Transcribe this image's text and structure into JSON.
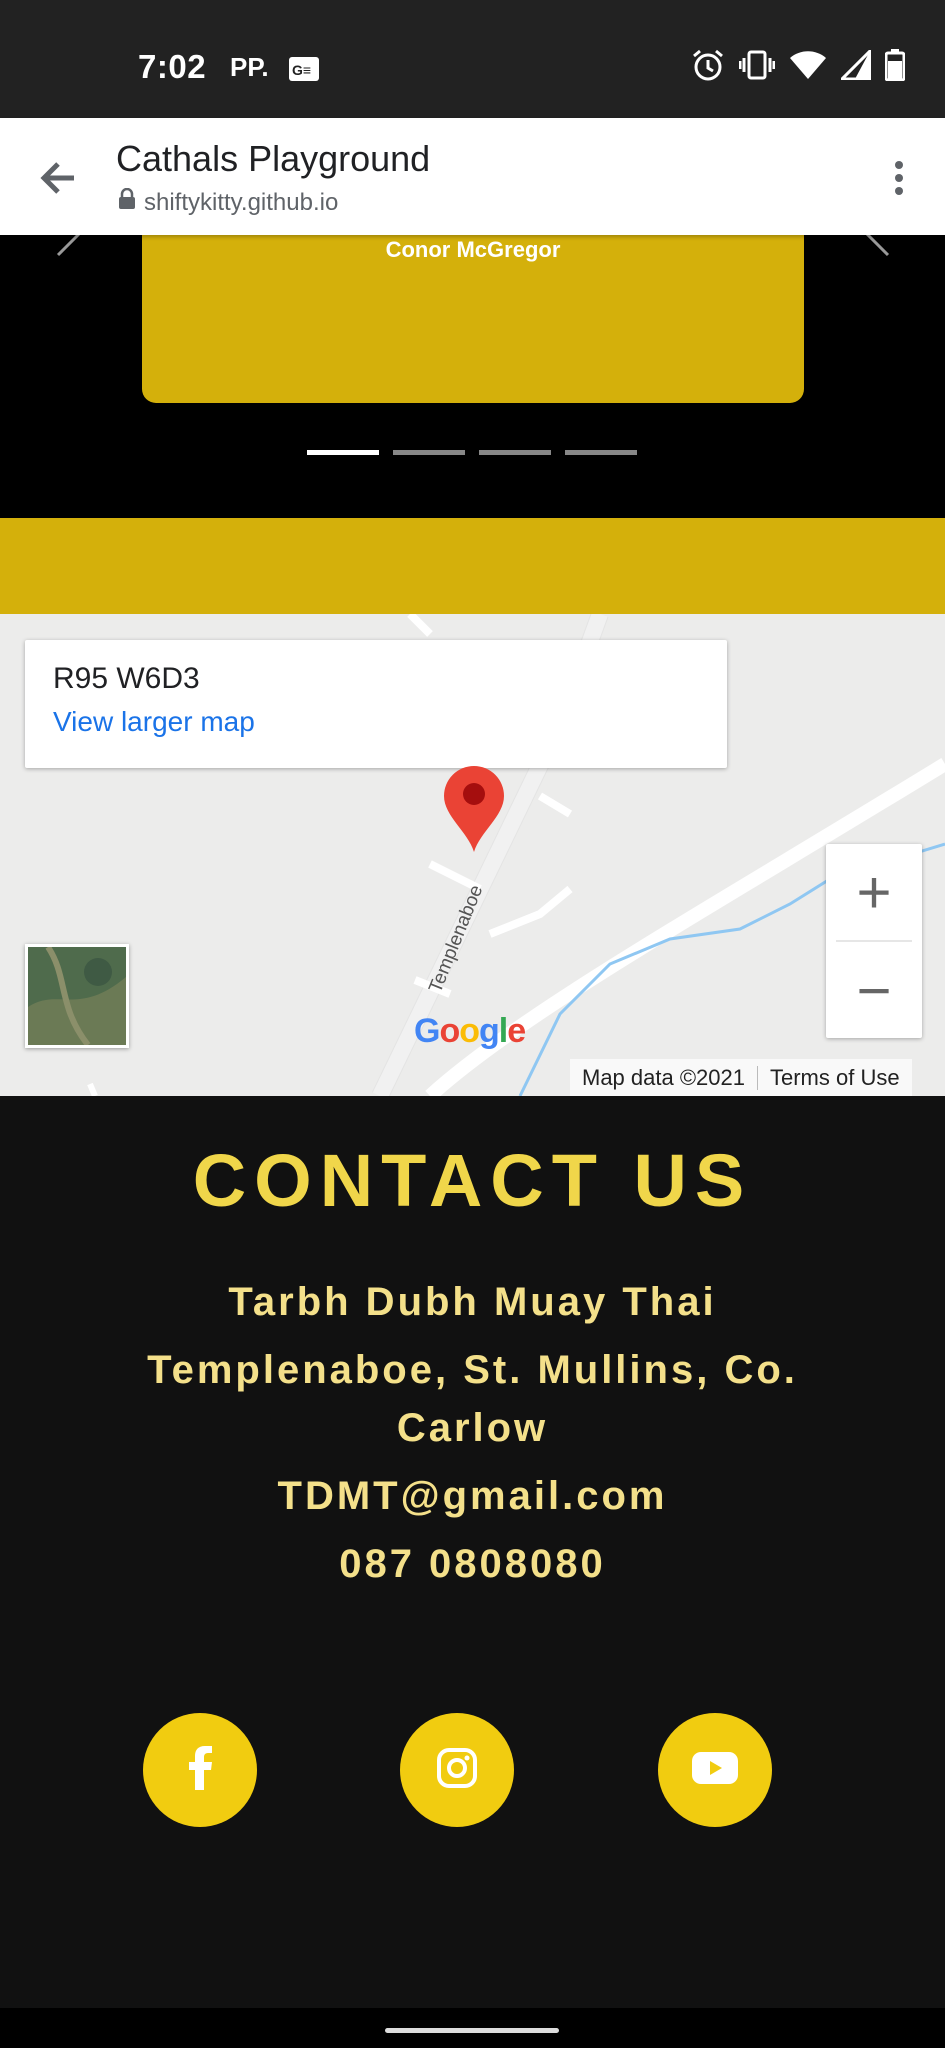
{
  "status_bar": {
    "time": "7:02",
    "carrier_label": "PP.",
    "icons": [
      "news-icon",
      "alarm-icon",
      "vibrate-icon",
      "wifi-icon",
      "signal-icon",
      "battery-icon"
    ]
  },
  "browser": {
    "title": "Cathals Playground",
    "url": "shiftykitty.github.io"
  },
  "carousel": {
    "card_label": "Conor McGregor",
    "indicator_count": 4,
    "active_index": 0
  },
  "map": {
    "place_code": "R95 W6D3",
    "view_larger_link": "View larger map",
    "road_label": "Templenaboe",
    "logo_text": "Google",
    "map_data": "Map data ©2021",
    "terms": "Terms of Use",
    "zoom_in": "+",
    "zoom_out": "−"
  },
  "contact": {
    "heading": "CONTACT US",
    "business_name": "Tarbh Dubh Muay Thai",
    "address_line1": "Templenaboe, St. Mullins, Co.",
    "address_line2": "Carlow",
    "email": "TDMT@gmail.com",
    "phone": "087 0808080"
  },
  "social": [
    "facebook-icon",
    "instagram-icon",
    "youtube-icon"
  ],
  "colors": {
    "accent_yellow": "#d4b00b",
    "social_yellow": "#f1cc10",
    "heading_yellow": "#f0d64a",
    "text_yellow": "#f4e08a",
    "link_blue": "#1a73e8",
    "page_bg": "#111111"
  }
}
